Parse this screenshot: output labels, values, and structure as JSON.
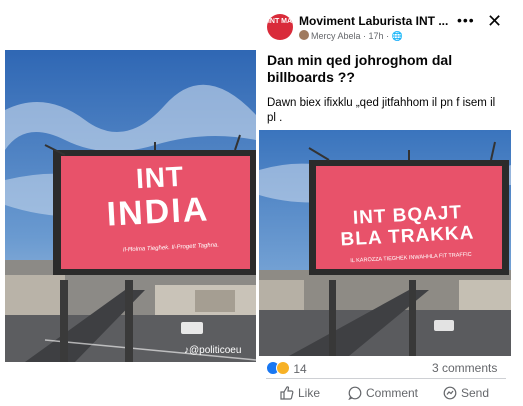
{
  "left_image": {
    "billboard_line1": "INT",
    "billboard_line2": "INDIA",
    "billboard_tagline": "Il-Ħolma Tiegħek. Il-Progett Tagħna.",
    "watermark": "@politicoeu"
  },
  "post": {
    "page_logo": "INT MA",
    "page_name": "Moviment Laburista INT ...",
    "author": "Mercy Abela",
    "time": "17h",
    "title": "Dan min qed johroghom dal billboards ??",
    "text": "Dawn biex ifixklu „qed jitfahhom il pn f isem il pl .",
    "image": {
      "billboard_line1": "INT BQAJT",
      "billboard_line2": "BLA TRAKKA",
      "billboard_tagline": "IL KAROZZA TIEGHEK INWAHHLA FIT TRAFFIC"
    },
    "reactions_count": "14",
    "comments_count": "3 comments",
    "actions": {
      "like": "Like",
      "comment": "Comment",
      "send": "Send"
    }
  },
  "colors": {
    "billboard_pink": "#e8526a",
    "billboard_text": "#ffffff",
    "sky": "#3a74bd",
    "page_logo": "#d92b3a"
  }
}
